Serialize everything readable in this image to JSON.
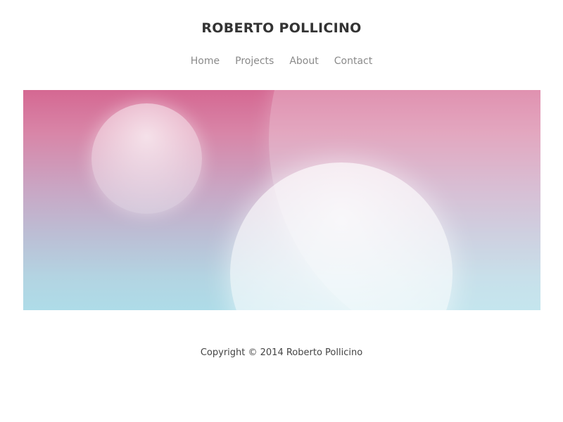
{
  "header": {
    "site_title": "ROBERTO POLLICINO"
  },
  "nav": {
    "items": [
      {
        "label": "Home"
      },
      {
        "label": "Projects"
      },
      {
        "label": "About"
      },
      {
        "label": "Contact"
      }
    ]
  },
  "hero": {
    "gradient_colors": [
      "#d56892",
      "#d886a8",
      "#c9a6c4",
      "#bcbdd4",
      "#b3d4e2",
      "#aedce8"
    ],
    "bubble_color": "#ffffff"
  },
  "footer": {
    "copyright": "Copyright © 2014 Roberto Pollicino"
  }
}
